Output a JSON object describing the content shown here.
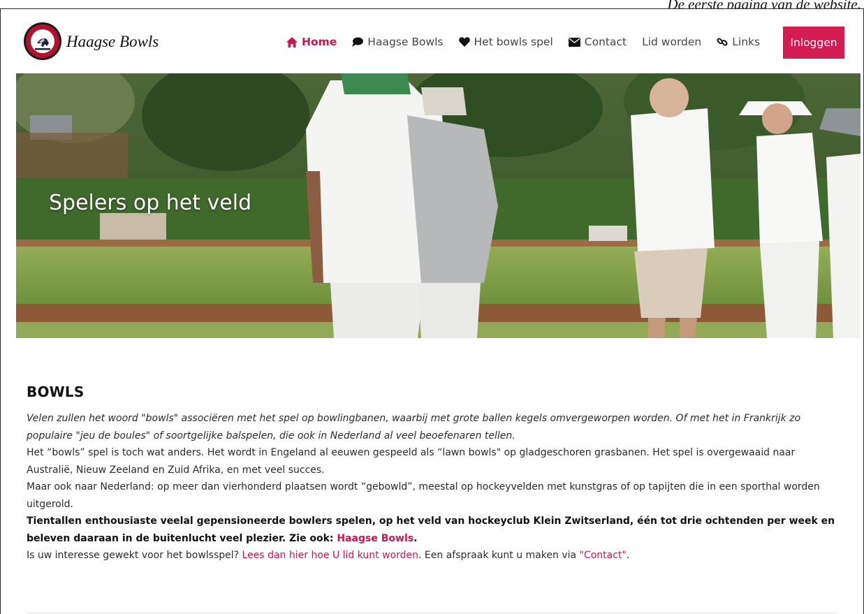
{
  "caption": "De eerste pagina van de website.",
  "header": {
    "site_name": "Haagse Bowls",
    "logo_text": "HAAGSE BOWLS",
    "nav": [
      {
        "label": "Home",
        "icon": "home-icon",
        "active": true
      },
      {
        "label": "Haagse Bowls",
        "icon": "comment-icon",
        "active": false
      },
      {
        "label": "Het bowls spel",
        "icon": "heart-icon",
        "active": false
      },
      {
        "label": "Contact",
        "icon": "envelope-icon",
        "active": false
      },
      {
        "label": "Lid worden",
        "icon": "",
        "active": false
      },
      {
        "label": "Links",
        "icon": "link-icon",
        "active": false
      }
    ],
    "login_label": "Inloggen"
  },
  "hero": {
    "title": "Spelers op het veld"
  },
  "main": {
    "heading": "BOWLS",
    "intro_italic": "Velen zullen het woord \"bowls\" associëren met het spel op bowlingbanen, waarbij met grote ballen kegels omvergeworpen worden. Of met het in Frankrijk zo populaire \"jeu de boules\" of soortgelijke balspelen, die ook in Nederland al veel beoefenaren tellen.",
    "para2": "Het “bowls” spel is toch wat anders. Het wordt in Engeland al eeuwen gespeeld als “lawn bowls\" op gladgeschoren grasbanen. Het spel is overgewaaid naar Australië, Nieuw Zeeland en Zuid Afrika, en met veel succes.",
    "para3": "Maar ook naar Nederland: op meer dan vierhonderd plaatsen wordt “gebowld”, meestal op hockeyvelden met kunstgras of op tapijten die in een sporthal worden uitgerold.",
    "para4_text": "Tientallen enthousiaste veelal gepensioneerde bowlers spelen, op het veld van hockeyclub Klein Zwitserland, één tot drie ochtenden per week en beleven daaraan in de buitenlucht veel plezier. Zie ook: ",
    "para4_link": "Haagse Bowls",
    "para4_end": ".",
    "para5_start": "Is uw interesse gewekt voor het bowlsspel? ",
    "para5_link1": "Lees dan hier hoe U lid kunt worden",
    "para5_middle": ". Een afspraak kunt u maken via ",
    "para5_link2": "\"Contact\"",
    "para5_end": "."
  },
  "colors": {
    "accent": "#d31d52",
    "link": "#c8164f"
  }
}
